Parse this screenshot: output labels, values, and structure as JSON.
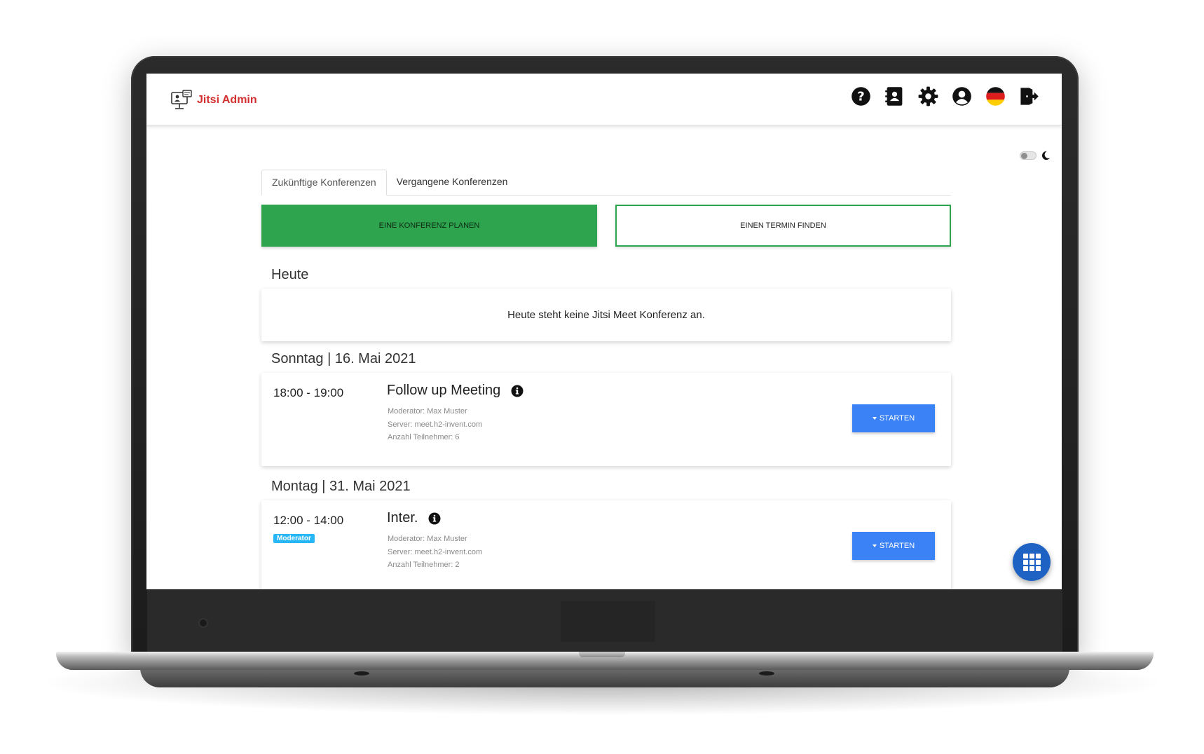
{
  "app": {
    "title": "Jitsi Admin",
    "brand_color": "#d32f2f"
  },
  "header": {
    "icons": [
      "help-icon",
      "contacts-icon",
      "settings-icon",
      "profile-icon",
      "language-flag-de-icon",
      "logout-icon"
    ]
  },
  "tabs": [
    {
      "label": "Zukünftige Konferenzen",
      "active": true
    },
    {
      "label": "Vergangene Konferenzen",
      "active": false
    }
  ],
  "actions": {
    "plan_label": "EINE KONFERENZ PLANEN",
    "find_label": "EINEN TERMIN FINDEN",
    "accent_color": "#2ea44f"
  },
  "today": {
    "heading": "Heute",
    "empty_text": "Heute steht keine Jitsi Meet Konferenz an."
  },
  "days": [
    {
      "heading": "Sonntag | 16. Mai 2021",
      "conference": {
        "time": "18:00 - 19:00",
        "title": "Follow up Meeting",
        "moderator": "Moderator: Max Muster",
        "server": "Server: meet.h2-invent.com",
        "participants": "Anzahl Teilnehmer: 6",
        "start_label": "STARTEN"
      }
    },
    {
      "heading": "Montag | 31. Mai 2021",
      "conference": {
        "time": "12:00 - 14:00",
        "badge": "Moderator",
        "title": "Inter.",
        "moderator": "Moderator: Max Muster",
        "server": "Server: meet.h2-invent.com",
        "participants": "Anzahl Teilnehmer: 2",
        "start_label": "STARTEN"
      }
    }
  ],
  "colors": {
    "start_button": "#3b82f6",
    "fab": "#1e63c4",
    "badge": "#29b6f6"
  }
}
